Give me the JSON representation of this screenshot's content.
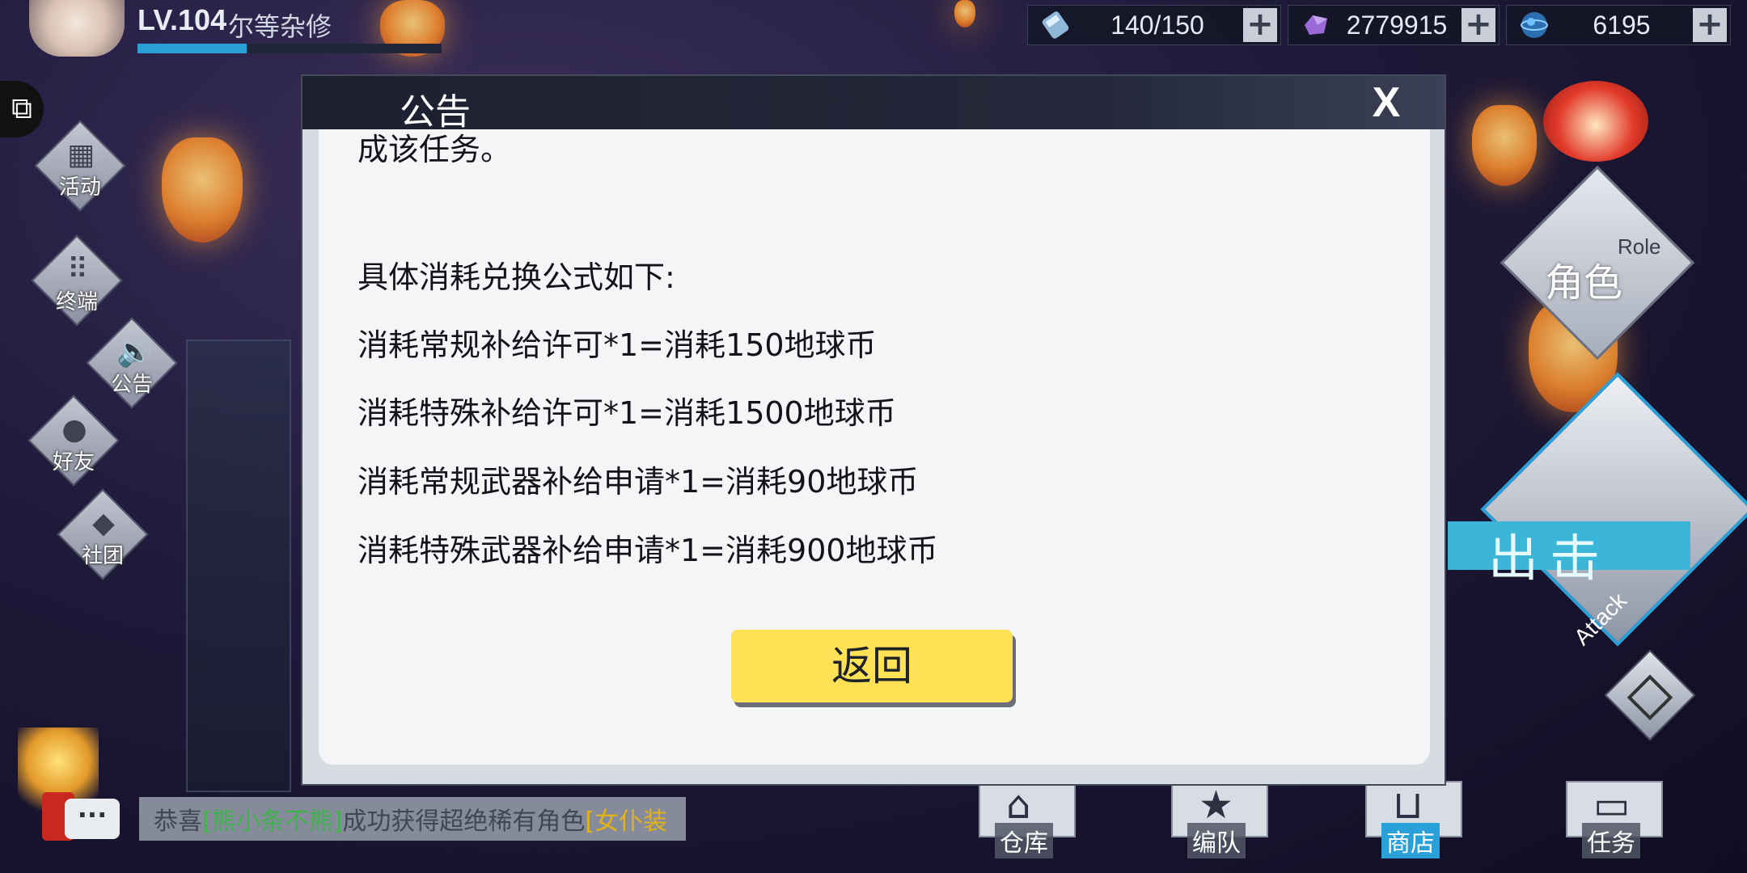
{
  "player": {
    "level": "LV.104",
    "name": "尔等杂修",
    "xp_progress": 0.36
  },
  "resources": [
    {
      "icon": "stamina-icon",
      "value": "140/150"
    },
    {
      "icon": "crystal-icon",
      "value": "2779915"
    },
    {
      "icon": "earth-coin-icon",
      "value": "6195"
    }
  ],
  "left_menu": {
    "activity": "活动",
    "terminal": "终端",
    "announcement": "公告",
    "friends": "好友",
    "club": "社团"
  },
  "right_menu": {
    "role_cn": "角色",
    "role_en": "Role",
    "attack_cn": "出击",
    "attack_en": "Attack"
  },
  "chat": {
    "button": "···",
    "prefix": "恭喜",
    "player": "[熊小条不熊]",
    "middle": "成功获得超绝稀有角色",
    "item": "[女仆装"
  },
  "bottom_nav": [
    {
      "label": "仓库",
      "icon": "warehouse-icon",
      "active": false
    },
    {
      "label": "编队",
      "icon": "formation-icon",
      "active": false
    },
    {
      "label": "商店",
      "icon": "shop-icon",
      "active": true
    },
    {
      "label": "任务",
      "icon": "task-icon",
      "active": false
    }
  ],
  "modal": {
    "title": "公告",
    "close": "X",
    "lines": [
      "成该任务。",
      "具体消耗兑换公式如下:",
      "消耗常规补给许可*1=消耗150地球币",
      "消耗特殊补给许可*1=消耗1500地球币",
      "消耗常规武器补给申请*1=消耗90地球币",
      "消耗特殊武器补给申请*1=消耗900地球币"
    ],
    "return_button": "返回"
  },
  "colors": {
    "accent": "#2aa0d8",
    "button_yellow": "#fee155",
    "modal_bg": "#f4f5f7"
  }
}
